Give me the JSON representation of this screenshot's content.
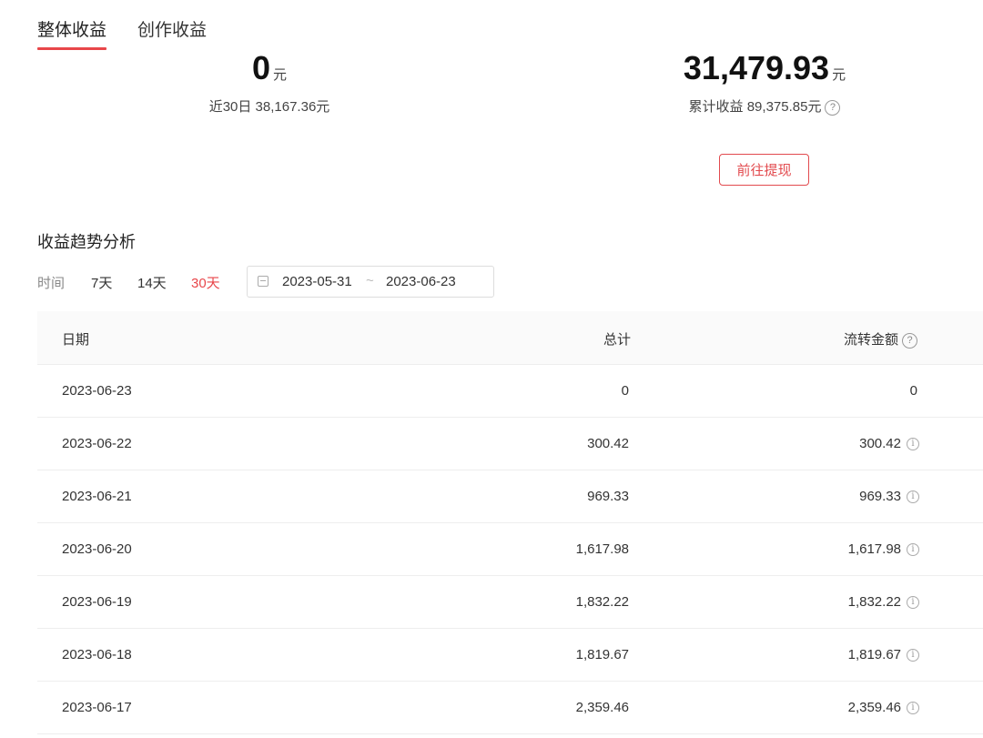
{
  "tabs": [
    {
      "label": "整体收益",
      "active": true
    },
    {
      "label": "创作收益",
      "active": false
    }
  ],
  "summary": {
    "today": {
      "value": "0",
      "unit": "元",
      "sub": "近30日 38,167.36元"
    },
    "balance": {
      "value": "31,479.93",
      "unit": "元",
      "sub": "累计收益 89,375.85元"
    },
    "withdraw_label": "前往提现"
  },
  "trend": {
    "title": "收益趋势分析",
    "time_label": "时间",
    "ranges": [
      "7天",
      "14天",
      "30天"
    ],
    "active_range": "30天",
    "date_start": "2023-05-31",
    "date_sep": "~",
    "date_end": "2023-06-23"
  },
  "table": {
    "headers": [
      "日期",
      "总计",
      "流转金额"
    ],
    "rows": [
      {
        "date": "2023-06-23",
        "total": "0",
        "flow": "0",
        "info": false
      },
      {
        "date": "2023-06-22",
        "total": "300.42",
        "flow": "300.42",
        "info": true
      },
      {
        "date": "2023-06-21",
        "total": "969.33",
        "flow": "969.33",
        "info": true
      },
      {
        "date": "2023-06-20",
        "total": "1,617.98",
        "flow": "1,617.98",
        "info": true
      },
      {
        "date": "2023-06-19",
        "total": "1,832.22",
        "flow": "1,832.22",
        "info": true
      },
      {
        "date": "2023-06-18",
        "total": "1,819.67",
        "flow": "1,819.67",
        "info": true
      },
      {
        "date": "2023-06-17",
        "total": "2,359.46",
        "flow": "2,359.46",
        "info": true
      }
    ]
  },
  "colors": {
    "accent": "#e8464a"
  }
}
